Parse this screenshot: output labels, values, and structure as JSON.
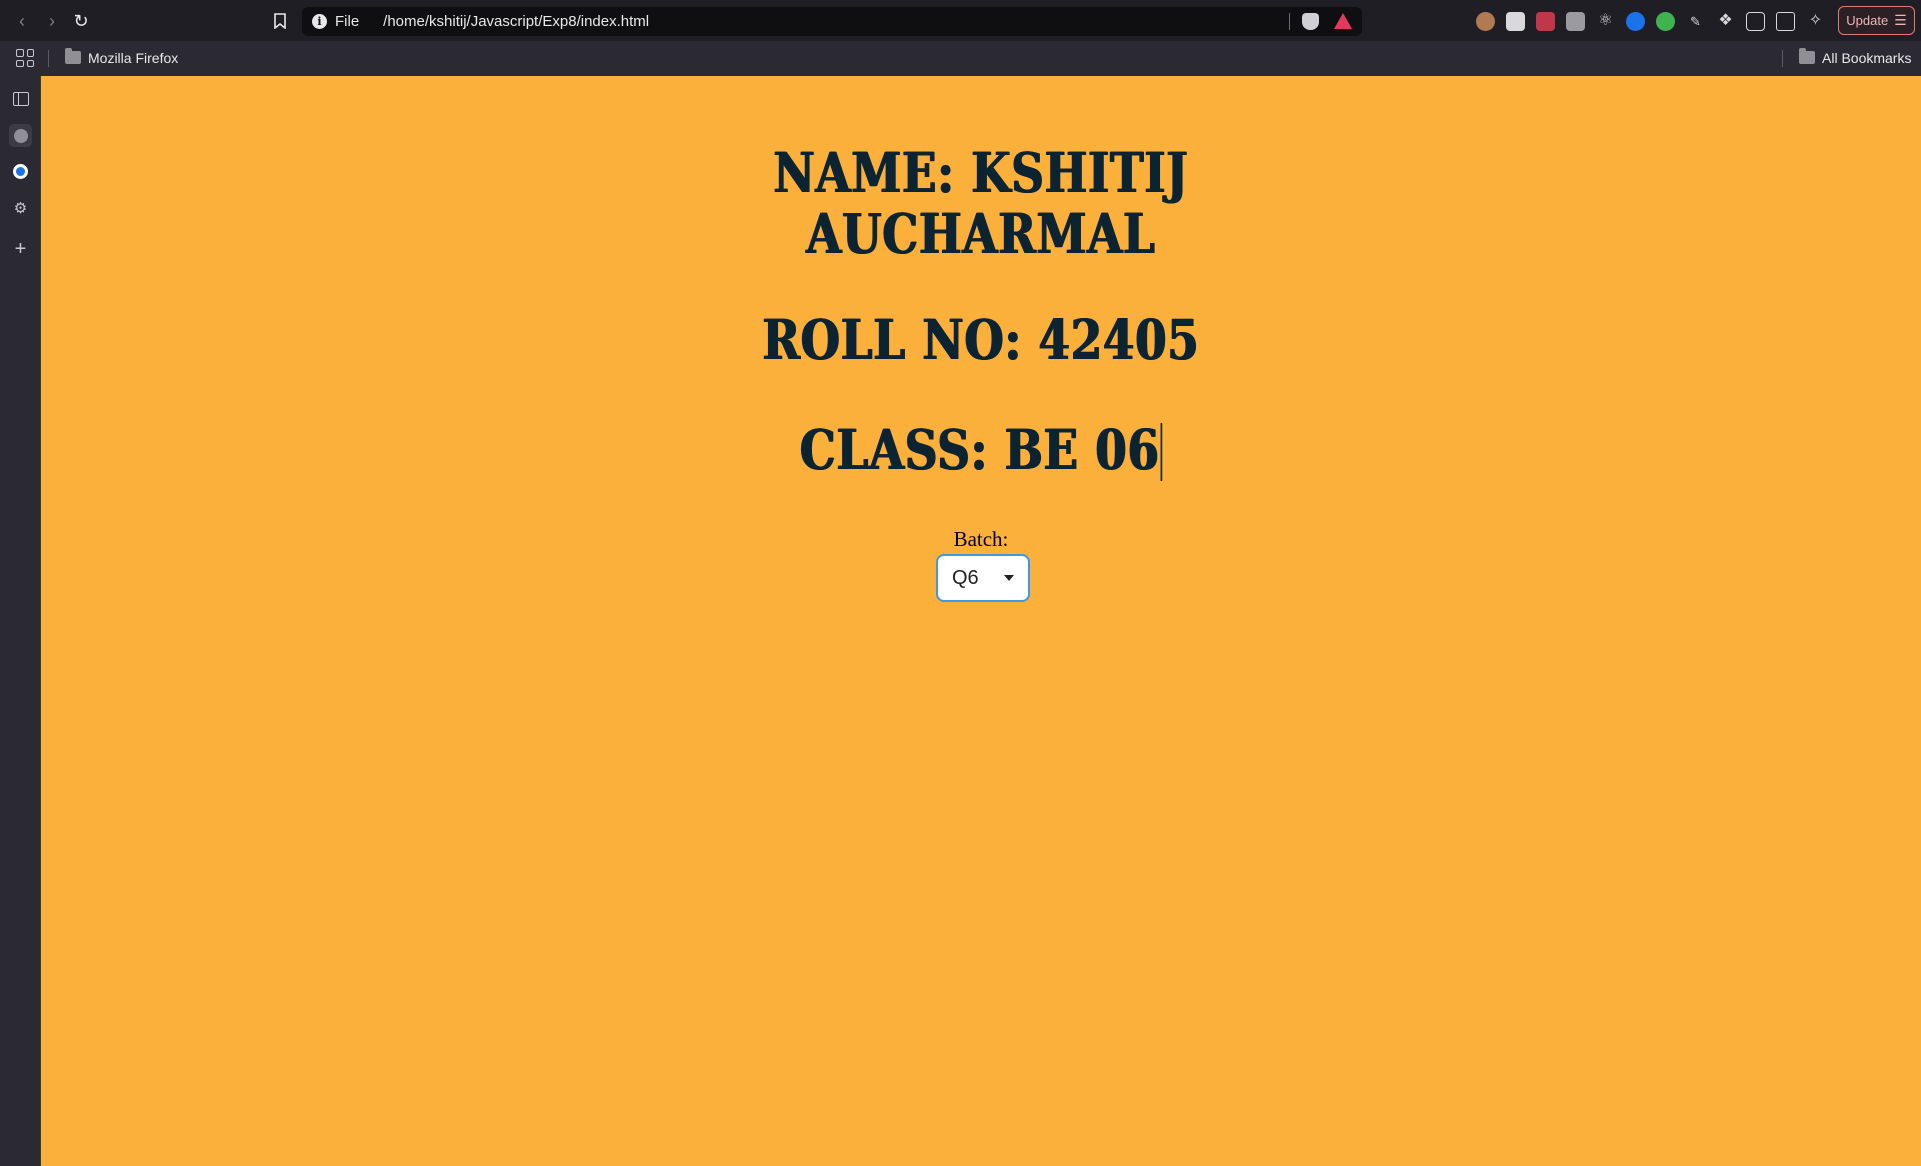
{
  "browser": {
    "url_scheme": "File",
    "url_path": "/home/kshitij/Javascript/Exp8/index.html",
    "update_label": "Update",
    "icons": {
      "back": "back-arrow-icon",
      "forward": "forward-arrow-icon",
      "reload": "reload-icon",
      "bookmark": "bookmark-icon",
      "info": "info-icon",
      "brave_shields": "brave-shield-icon",
      "rewards": "brave-rewards-icon",
      "menu": "hamburger-menu-icon"
    }
  },
  "bookmarks": {
    "items": [
      {
        "label": "Mozilla Firefox"
      }
    ],
    "all_label": "All Bookmarks"
  },
  "page": {
    "background": "#fbb03b",
    "heading_color": "#0c2431",
    "name_line1": "NAME: KSHITIJ",
    "name_line2": "AUCHARMAL",
    "roll": "ROLL NO: 42405",
    "class": "CLASS: BE 06",
    "batch_label": "Batch:",
    "batch_selected": "Q6"
  }
}
